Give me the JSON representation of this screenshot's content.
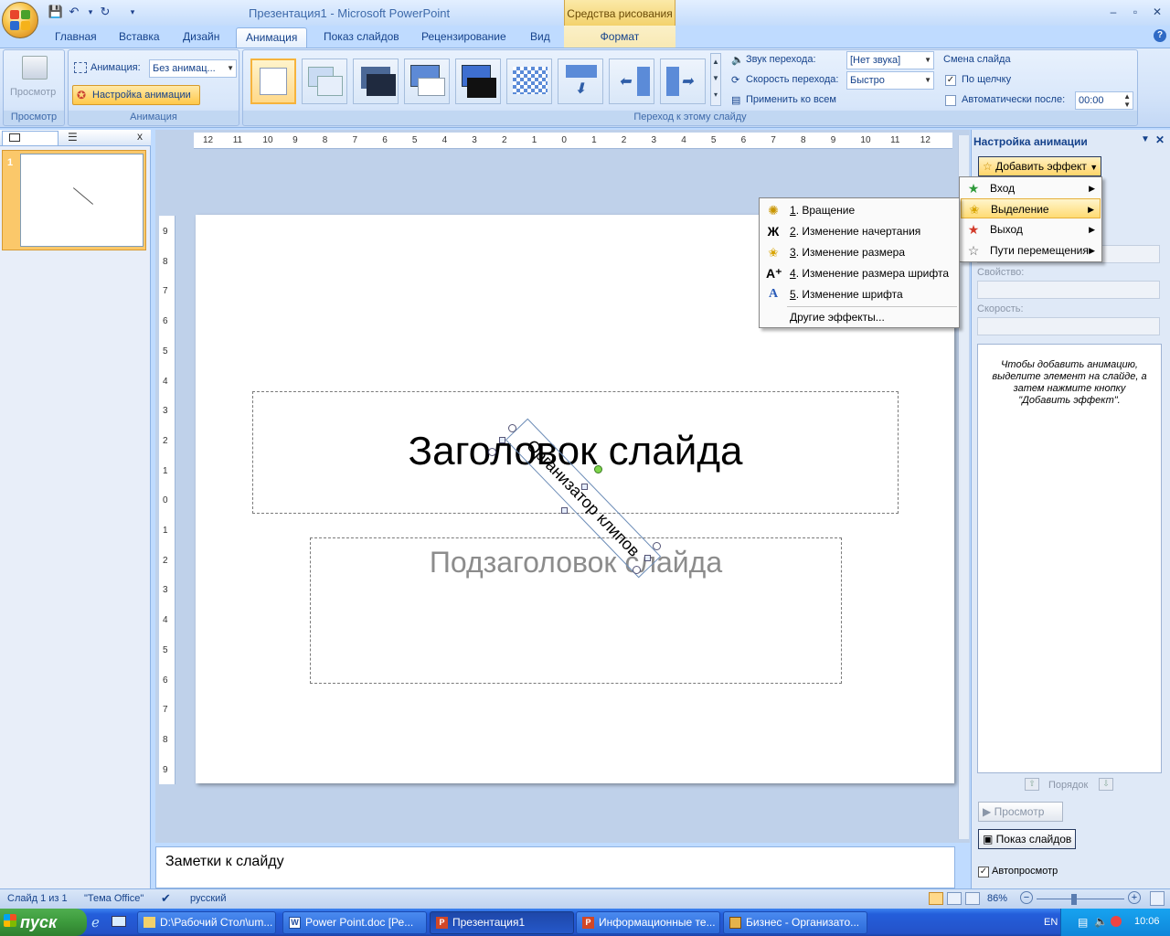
{
  "window": {
    "title": "Презентация1 - Microsoft PowerPoint",
    "context_tools": "Средства рисования",
    "minimize": "–",
    "restore": "▫",
    "close": "✕"
  },
  "quick_access": {
    "undo": "↶",
    "redo": "↻",
    "dropdown": "▾"
  },
  "tabs": [
    "Главная",
    "Вставка",
    "Дизайн",
    "Анимация",
    "Показ слайдов",
    "Рецензирование",
    "Вид"
  ],
  "active_tab": "Анимация",
  "format_tab": "Формат",
  "ribbon": {
    "preview": {
      "button": "Просмотр",
      "group": "Просмотр"
    },
    "animation": {
      "label": "Анимация:",
      "value": "Без анимац...",
      "custom_button": "Настройка анимации",
      "group": "Анимация"
    },
    "transition": {
      "group": "Переход к этому слайду",
      "sound_label": "Звук перехода:",
      "sound_value": "[Нет звука]",
      "speed_label": "Скорость перехода:",
      "speed_value": "Быстро",
      "apply_all": "Применить ко всем"
    },
    "advance": {
      "title": "Смена слайда",
      "on_click": "По щелчку",
      "on_click_checked": true,
      "auto_after": "Автоматически после:",
      "auto_checked": false,
      "auto_value": "00:00"
    }
  },
  "slides_pane": {
    "slide_number": "1",
    "close": "x"
  },
  "ruler": {
    "h_ticks": [
      "12",
      "11",
      "10",
      "9",
      "8",
      "7",
      "6",
      "5",
      "4",
      "3",
      "2",
      "1",
      "0",
      "1",
      "2",
      "3",
      "4",
      "5",
      "6",
      "7",
      "8",
      "9",
      "10",
      "11",
      "12"
    ],
    "v_ticks": [
      "9",
      "8",
      "7",
      "6",
      "5",
      "4",
      "3",
      "2",
      "1",
      "0",
      "1",
      "2",
      "3",
      "4",
      "5",
      "6",
      "7",
      "8",
      "9"
    ]
  },
  "slide": {
    "title": "Заголовок слайда",
    "subtitle": "Подзаголовок слайда",
    "rotated_text": "Организатор клипов"
  },
  "notes": {
    "text": "Заметки к слайду"
  },
  "task_pane": {
    "title": "Настройка анимации",
    "add_effect": "Добавить эффект",
    "property_label": "Свойство:",
    "speed_label": "Скорость:",
    "info": "Чтобы добавить анимацию, выделите элемент на слайде, а затем нажмите кнопку \"Добавить эффект\".",
    "order_label": "Порядок",
    "preview_button": "Просмотр",
    "slideshow_button": "Показ слайдов",
    "autopreview": "Автопросмотр",
    "autopreview_checked": true
  },
  "add_effect_menu": [
    {
      "label": "Вход",
      "icon": "entrance-icon",
      "highlighted": false
    },
    {
      "label": "Выделение",
      "icon": "emphasis-icon",
      "highlighted": true
    },
    {
      "label": "Выход",
      "icon": "exit-icon",
      "highlighted": false
    },
    {
      "label": "Пути перемещения",
      "icon": "motion-path-icon",
      "highlighted": false
    }
  ],
  "emphasis_submenu": [
    {
      "num": "1",
      "label": ". Вращение",
      "icon": "spin-icon"
    },
    {
      "num": "2",
      "label": ". Изменение начертания",
      "icon": "bold-icon"
    },
    {
      "num": "3",
      "label": ". Изменение размера",
      "icon": "grow-icon"
    },
    {
      "num": "4",
      "label": ". Изменение размера шрифта",
      "icon": "font-size-icon"
    },
    {
      "num": "5",
      "label": ". Изменение шрифта",
      "icon": "font-icon"
    },
    {
      "num": "",
      "label": "Другие эффекты...",
      "icon": ""
    }
  ],
  "status_bar": {
    "slide": "Слайд 1 из 1",
    "theme": "\"Тема Office\"",
    "language": "русский",
    "zoom": "86%"
  },
  "taskbar": {
    "start": "пуск",
    "tasks": [
      "D:\\Рабочий Стол\\um...",
      "Power Point.doc [Ре...",
      "Презентация1",
      "Информационные те...",
      "Бизнес - Организато..."
    ],
    "active_task": "Презентация1",
    "lang": "EN",
    "time": "10:06"
  },
  "colors": {
    "ribbon_blue": "#bfdbff",
    "highlight": "#ffdb73",
    "taskbar": "#245edb",
    "start": "#3c9a3c"
  }
}
